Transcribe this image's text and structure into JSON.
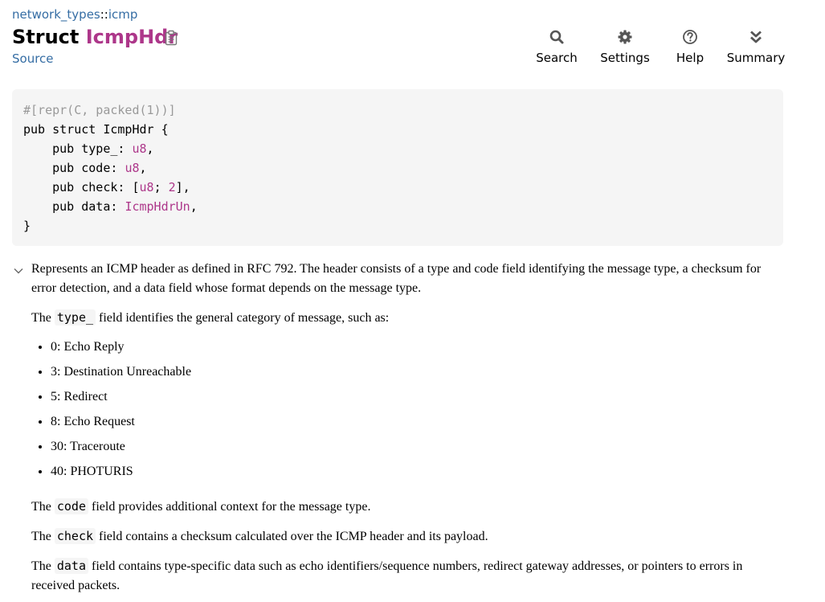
{
  "breadcrumb": {
    "crate": "network_types",
    "separator": "::",
    "module": "icmp"
  },
  "header": {
    "kind": "Struct",
    "name": "IcmpHdr",
    "source_label": "Source",
    "copy_icon": "clipboard-icon"
  },
  "toolbar": {
    "search_label": "Search",
    "settings_label": "Settings",
    "help_label": "Help",
    "summary_label": "Summary"
  },
  "code": {
    "attr": "#[repr(C, packed(1))]",
    "line1": "pub struct IcmpHdr {",
    "f1_prefix": "    pub type_: ",
    "f1_type": "u8",
    "f1_suffix": ",",
    "f2_prefix": "    pub code: ",
    "f2_type": "u8",
    "f2_suffix": ",",
    "f3_prefix": "    pub check: [",
    "f3_type": "u8",
    "f3_mid": "; ",
    "f3_num": "2",
    "f3_suffix": "],",
    "f4_prefix": "    pub data: ",
    "f4_type": "IcmpHdrUn",
    "f4_suffix": ",",
    "close": "}"
  },
  "docs": {
    "intro": "Represents an ICMP header as defined in RFC 792. The header consists of a type and code field identifying the message type, a checksum for error detection, and a data field whose format depends on the message type.",
    "type_pre": "The ",
    "type_code": "type_",
    "type_post": " field identifies the general category of message, such as:",
    "list": [
      "0: Echo Reply",
      "3: Destination Unreachable",
      "5: Redirect",
      "8: Echo Request",
      "30: Traceroute",
      "40: PHOTURIS"
    ],
    "code_pre": "The ",
    "code_code": "code",
    "code_post": " field provides additional context for the message type.",
    "check_pre": "The ",
    "check_code": "check",
    "check_post": " field contains a checksum calculated over the ICMP header and its payload.",
    "data_pre": "The ",
    "data_code": "data",
    "data_post": " field contains type-specific data such as echo identifiers/sequence numbers, redirect gateway addresses, or pointers to errors in received packets."
  },
  "colors": {
    "link": "#356da4",
    "struct_name": "#ad378a",
    "code_bg": "#f5f5f5",
    "attr": "#999999"
  }
}
